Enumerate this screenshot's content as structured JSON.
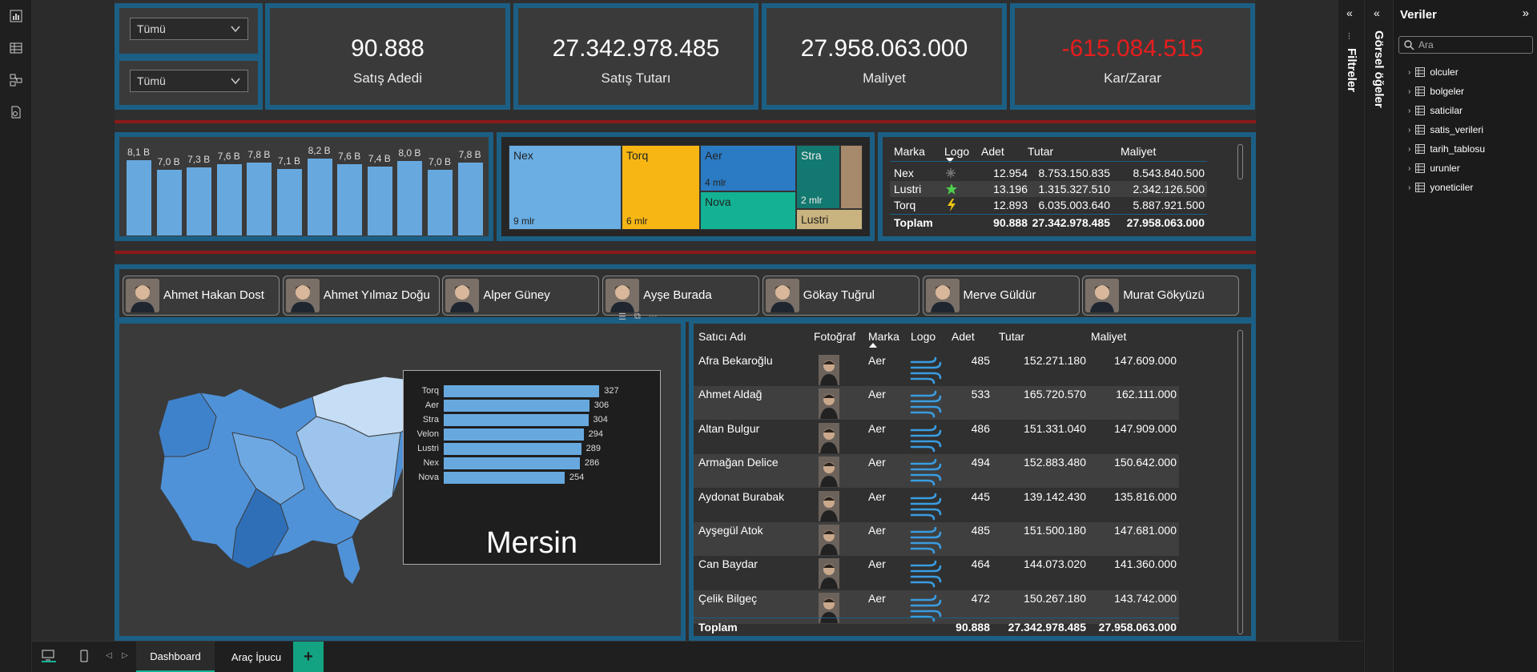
{
  "filters": {
    "dropdown1": "Tümü",
    "dropdown2": "Tümü"
  },
  "kpis": [
    {
      "value": "90.888",
      "label": "Satış Adedi",
      "color": "#ffffff"
    },
    {
      "value": "27.342.978.485",
      "label": "Satış Tutarı",
      "color": "#ffffff"
    },
    {
      "value": "27.958.063.000",
      "label": "Maliyet",
      "color": "#ffffff"
    },
    {
      "value": "-615.084.515",
      "label": "Kar/Zarar",
      "color": "#e81d1d"
    }
  ],
  "monthly_chart": {
    "chart_data": {
      "type": "bar",
      "values": [
        8.1,
        7.0,
        7.3,
        7.6,
        7.8,
        7.1,
        8.2,
        7.6,
        7.4,
        8.0,
        7.0,
        7.8
      ],
      "labels": [
        "8,1 B",
        "7,0 B",
        "7,3 B",
        "7,6 B",
        "7,8 B",
        "7,1 B",
        "8,2 B",
        "7,6 B",
        "7,4 B",
        "8,0 B",
        "7,0 B",
        "7,8 B"
      ]
    }
  },
  "treemap": {
    "chart_data": {
      "type": "treemap",
      "items": [
        {
          "name": "Nex",
          "label": "9 mlr",
          "color": "#6aaee3"
        },
        {
          "name": "Torq",
          "label": "6 mlr",
          "color": "#f7b614"
        },
        {
          "name": "Aer",
          "label": "4 mlr",
          "color": "#2b7bc4"
        },
        {
          "name": "Nova",
          "label": "",
          "color": "#13b294"
        },
        {
          "name": "Stra",
          "label": "2 mlr",
          "color": "#13786f"
        },
        {
          "name": "",
          "label": "",
          "color": "#a78a6b"
        },
        {
          "name": "Lustri",
          "label": "",
          "color": "#c9b37e"
        }
      ]
    }
  },
  "brand_table": {
    "headers": [
      "Marka",
      "Logo",
      "Adet",
      "Tutar",
      "Maliyet"
    ],
    "rows": [
      {
        "marka": "Nex",
        "logo": "snowflake-icon",
        "adet": "12.954",
        "tutar": "8.753.150.835",
        "maliyet": "8.543.840.500"
      },
      {
        "marka": "Lustri",
        "logo": "star-icon",
        "adet": "13.196",
        "tutar": "1.315.327.510",
        "maliyet": "2.342.126.500"
      },
      {
        "marka": "Torq",
        "logo": "bolt-icon",
        "adet": "12.893",
        "tutar": "6.035.003.640",
        "maliyet": "5.887.921.500"
      }
    ],
    "total": {
      "label": "Toplam",
      "adet": "90.888",
      "tutar": "27.342.978.485",
      "maliyet": "27.958.063.000"
    }
  },
  "salespeople": [
    "Ahmet Hakan Dost",
    "Ahmet Yılmaz Doğu",
    "Alper Güney",
    "Ayşe Burada",
    "Gökay Tuğrul",
    "Merve Güldür",
    "Murat Gökyüzü"
  ],
  "map_tooltip": {
    "city": "Mersin",
    "chart_data": {
      "type": "bar",
      "categories": [
        "Torq",
        "Aer",
        "Stra",
        "Velon",
        "Lustri",
        "Nex",
        "Nova"
      ],
      "values": [
        327,
        306,
        304,
        294,
        289,
        286,
        254
      ]
    }
  },
  "seller_table": {
    "headers": [
      "Satıcı Adı",
      "Fotoğraf",
      "Marka",
      "Logo",
      "Adet",
      "Tutar",
      "Maliyet"
    ],
    "rows": [
      {
        "name": "Afra Bekaroğlu",
        "marka": "Aer",
        "adet": "485",
        "tutar": "152.271.180",
        "maliyet": "147.609.000"
      },
      {
        "name": "Ahmet Aldağ",
        "marka": "Aer",
        "adet": "533",
        "tutar": "165.720.570",
        "maliyet": "162.111.000"
      },
      {
        "name": "Altan Bulgur",
        "marka": "Aer",
        "adet": "486",
        "tutar": "151.331.040",
        "maliyet": "147.909.000"
      },
      {
        "name": "Armağan Delice",
        "marka": "Aer",
        "adet": "494",
        "tutar": "152.883.480",
        "maliyet": "150.642.000"
      },
      {
        "name": "Aydonat Burabak",
        "marka": "Aer",
        "adet": "445",
        "tutar": "139.142.430",
        "maliyet": "135.816.000"
      },
      {
        "name": "Ayşegül Atok",
        "marka": "Aer",
        "adet": "485",
        "tutar": "151.500.180",
        "maliyet": "147.681.000"
      },
      {
        "name": "Can Baydar",
        "marka": "Aer",
        "adet": "464",
        "tutar": "144.073.020",
        "maliyet": "141.360.000"
      },
      {
        "name": "Çelik Bilgeç",
        "marka": "Aer",
        "adet": "472",
        "tutar": "150.267.180",
        "maliyet": "143.742.000"
      }
    ],
    "total": {
      "label": "Toplam",
      "adet": "90.888",
      "tutar": "27.342.978.485",
      "maliyet": "27.958.063.000"
    }
  },
  "panes": {
    "filters_label": "Filtreler",
    "visuals_label": "Görsel öğeler",
    "data_title": "Veriler",
    "search_placeholder": "Ara",
    "tables": [
      "olculer",
      "bolgeler",
      "saticilar",
      "satis_verileri",
      "tarih_tablosu",
      "urunler",
      "yoneticiler"
    ]
  },
  "page_tabs": [
    "Dashboard",
    "Araç İpucu"
  ],
  "accent": "#1c5f85"
}
